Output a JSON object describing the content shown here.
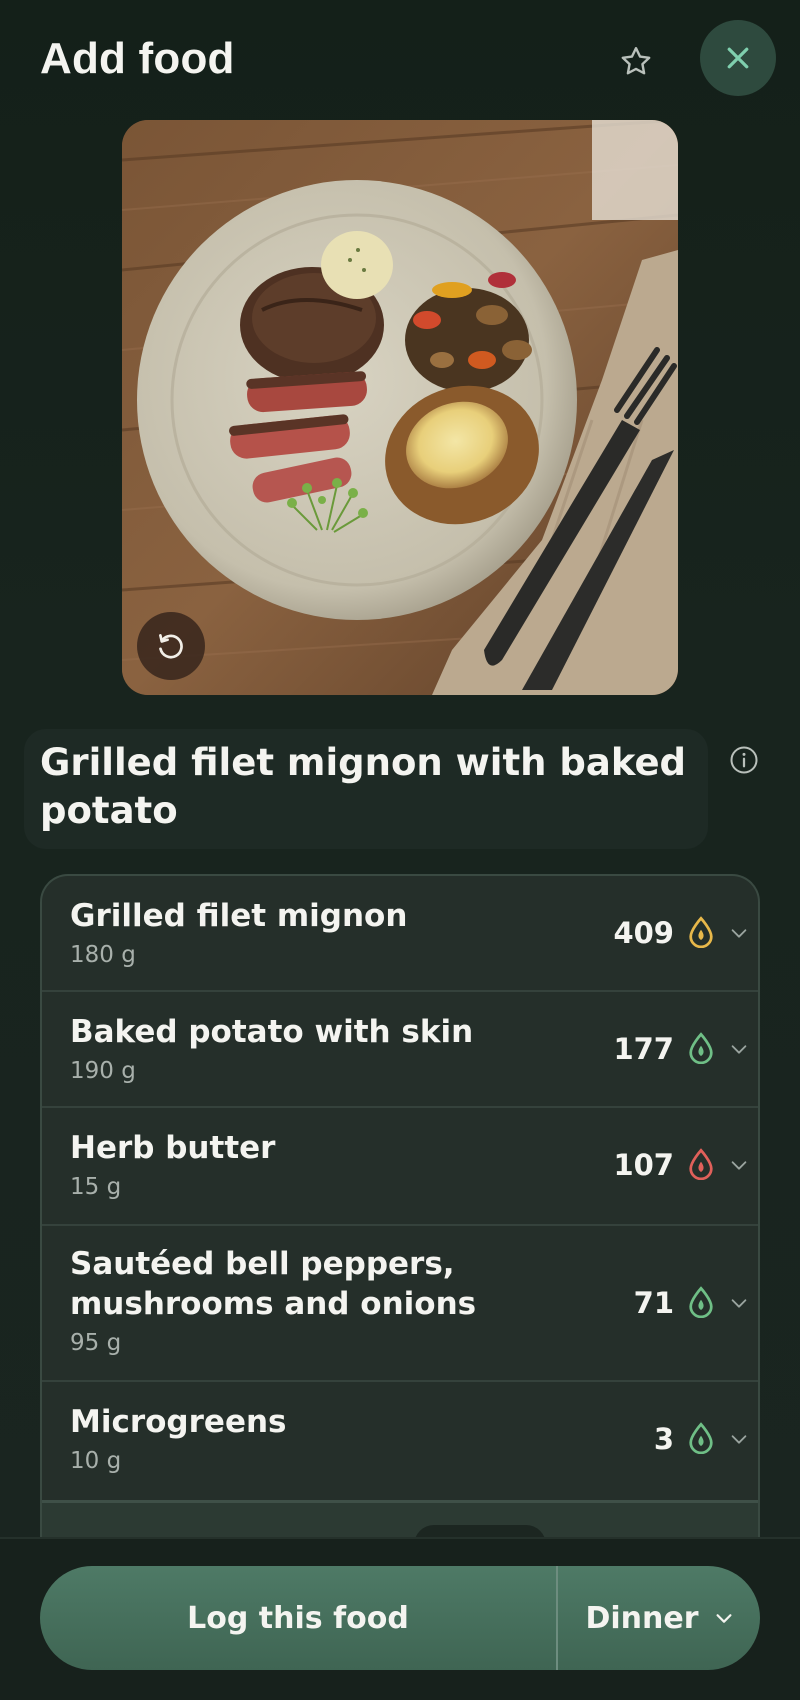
{
  "header": {
    "title": "Add food"
  },
  "food": {
    "name": "Grilled filet mignon with baked potato"
  },
  "items": [
    {
      "name": "Grilled filet mignon",
      "qty": "180 g",
      "calories": "409",
      "drop_color": "#e8b84a"
    },
    {
      "name": "Baked potato with skin",
      "qty": "190 g",
      "calories": "177",
      "drop_color": "#6fbf86"
    },
    {
      "name": "Herb butter",
      "qty": "15 g",
      "calories": "107",
      "drop_color": "#e0605a"
    },
    {
      "name": "Sautéed bell peppers, mushrooms and onions",
      "qty": "95 g",
      "calories": "71",
      "drop_color": "#6fbf86"
    },
    {
      "name": "Microgreens",
      "qty": "10 g",
      "calories": "3",
      "drop_color": "#6fbf86"
    }
  ],
  "actions": {
    "log_label": "Log this food",
    "meal_label": "Dinner"
  },
  "colors": {
    "accent": "#4a7461",
    "background": "#16221c",
    "card": "#252f2a"
  }
}
